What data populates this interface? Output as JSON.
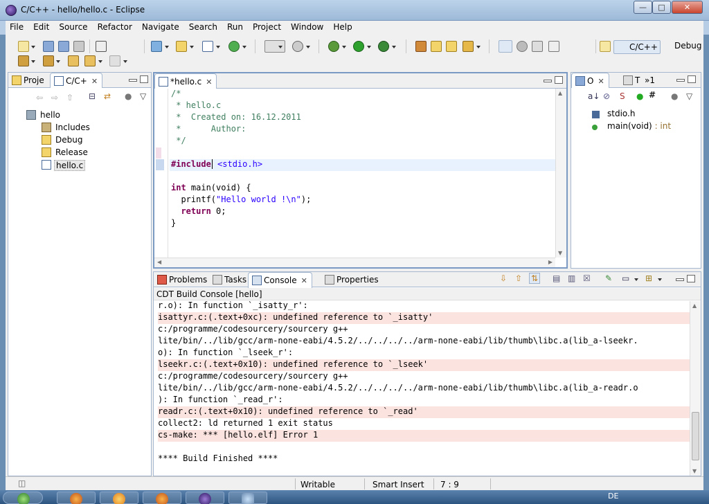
{
  "window": {
    "title": "C/C++ - hello/hello.c - Eclipse",
    "min": "—",
    "max": "□",
    "close": "✕"
  },
  "menu": [
    "File",
    "Edit",
    "Source",
    "Refactor",
    "Navigate",
    "Search",
    "Run",
    "Project",
    "Window",
    "Help"
  ],
  "perspectives": {
    "cc": "C/C++",
    "debug": "Debug"
  },
  "project_explorer": {
    "tabs": [
      "Proje",
      "C/C+"
    ],
    "tree": [
      {
        "label": "hello",
        "depth": 0,
        "icon": "c-project-icon"
      },
      {
        "label": "Includes",
        "depth": 1,
        "icon": "includes-icon"
      },
      {
        "label": "Debug",
        "depth": 1,
        "icon": "folder-icon"
      },
      {
        "label": "Release",
        "depth": 1,
        "icon": "folder-icon"
      },
      {
        "label": "hello.c",
        "depth": 1,
        "icon": "c-file-icon"
      }
    ]
  },
  "editor": {
    "tab": "*hello.c",
    "lines": [
      "/*",
      " * hello.c",
      " *  Created on: 16.12.2011",
      " *      Author:",
      " */",
      "",
      "#include <stdio.h>",
      "",
      "int main(void) {",
      "  printf(\"Hello world !\\n\");",
      "  return 0;",
      "}"
    ],
    "include_kw": "#include",
    "include_hdr": "<stdio.h>",
    "main_kw": "int",
    "main_rest": " main(void) {",
    "printf_a": "  printf(",
    "printf_str": "\"Hello world !\\n\"",
    "printf_b": ");",
    "return_kw": "  return",
    "return_rest": " 0;",
    "close_brace": "}"
  },
  "outline": {
    "tabs": [
      "O",
      "T",
      "»1"
    ],
    "items": [
      {
        "label": "stdio.h",
        "suffix": ""
      },
      {
        "label": "main(void)",
        "suffix": " : int"
      }
    ]
  },
  "console": {
    "tabs": [
      "Problems",
      "Tasks",
      "Console",
      "Properties"
    ],
    "header": "CDT Build Console [hello]",
    "lines": [
      {
        "text": "r.o): In function `_isatty_r':",
        "err": false
      },
      {
        "text": "isattyr.c:(.text+0xc): undefined reference to `_isatty'",
        "err": true
      },
      {
        "text": "c:/programme/codesourcery/sourcery g++",
        "err": false
      },
      {
        "text": "lite/bin/../lib/gcc/arm-none-eabi/4.5.2/../../../../arm-none-eabi/lib/thumb\\libc.a(lib_a-lseekr.",
        "err": false
      },
      {
        "text": "o): In function `_lseek_r':",
        "err": false
      },
      {
        "text": "lseekr.c:(.text+0x10): undefined reference to `_lseek'",
        "err": true
      },
      {
        "text": "c:/programme/codesourcery/sourcery g++",
        "err": false
      },
      {
        "text": "lite/bin/../lib/gcc/arm-none-eabi/4.5.2/../../../../arm-none-eabi/lib/thumb\\libc.a(lib_a-readr.o",
        "err": false
      },
      {
        "text": "): In function `_read_r':",
        "err": false
      },
      {
        "text": "readr.c:(.text+0x10): undefined reference to `_read'",
        "err": true
      },
      {
        "text": "collect2: ld returned 1 exit status",
        "err": false
      },
      {
        "text": "cs-make: *** [hello.elf] Error 1",
        "err": true
      },
      {
        "text": "",
        "err": false
      },
      {
        "text": "**** Build Finished ****",
        "err": false
      }
    ]
  },
  "status": {
    "writable": "Writable",
    "insert": "Smart Insert",
    "position": "7 : 9"
  },
  "tray": {
    "lang": "DE"
  },
  "colors": {
    "error_bg": "#fbe3e0",
    "comment": "#3f7f5f",
    "keyword": "#7f0055",
    "string": "#2a00ff"
  }
}
